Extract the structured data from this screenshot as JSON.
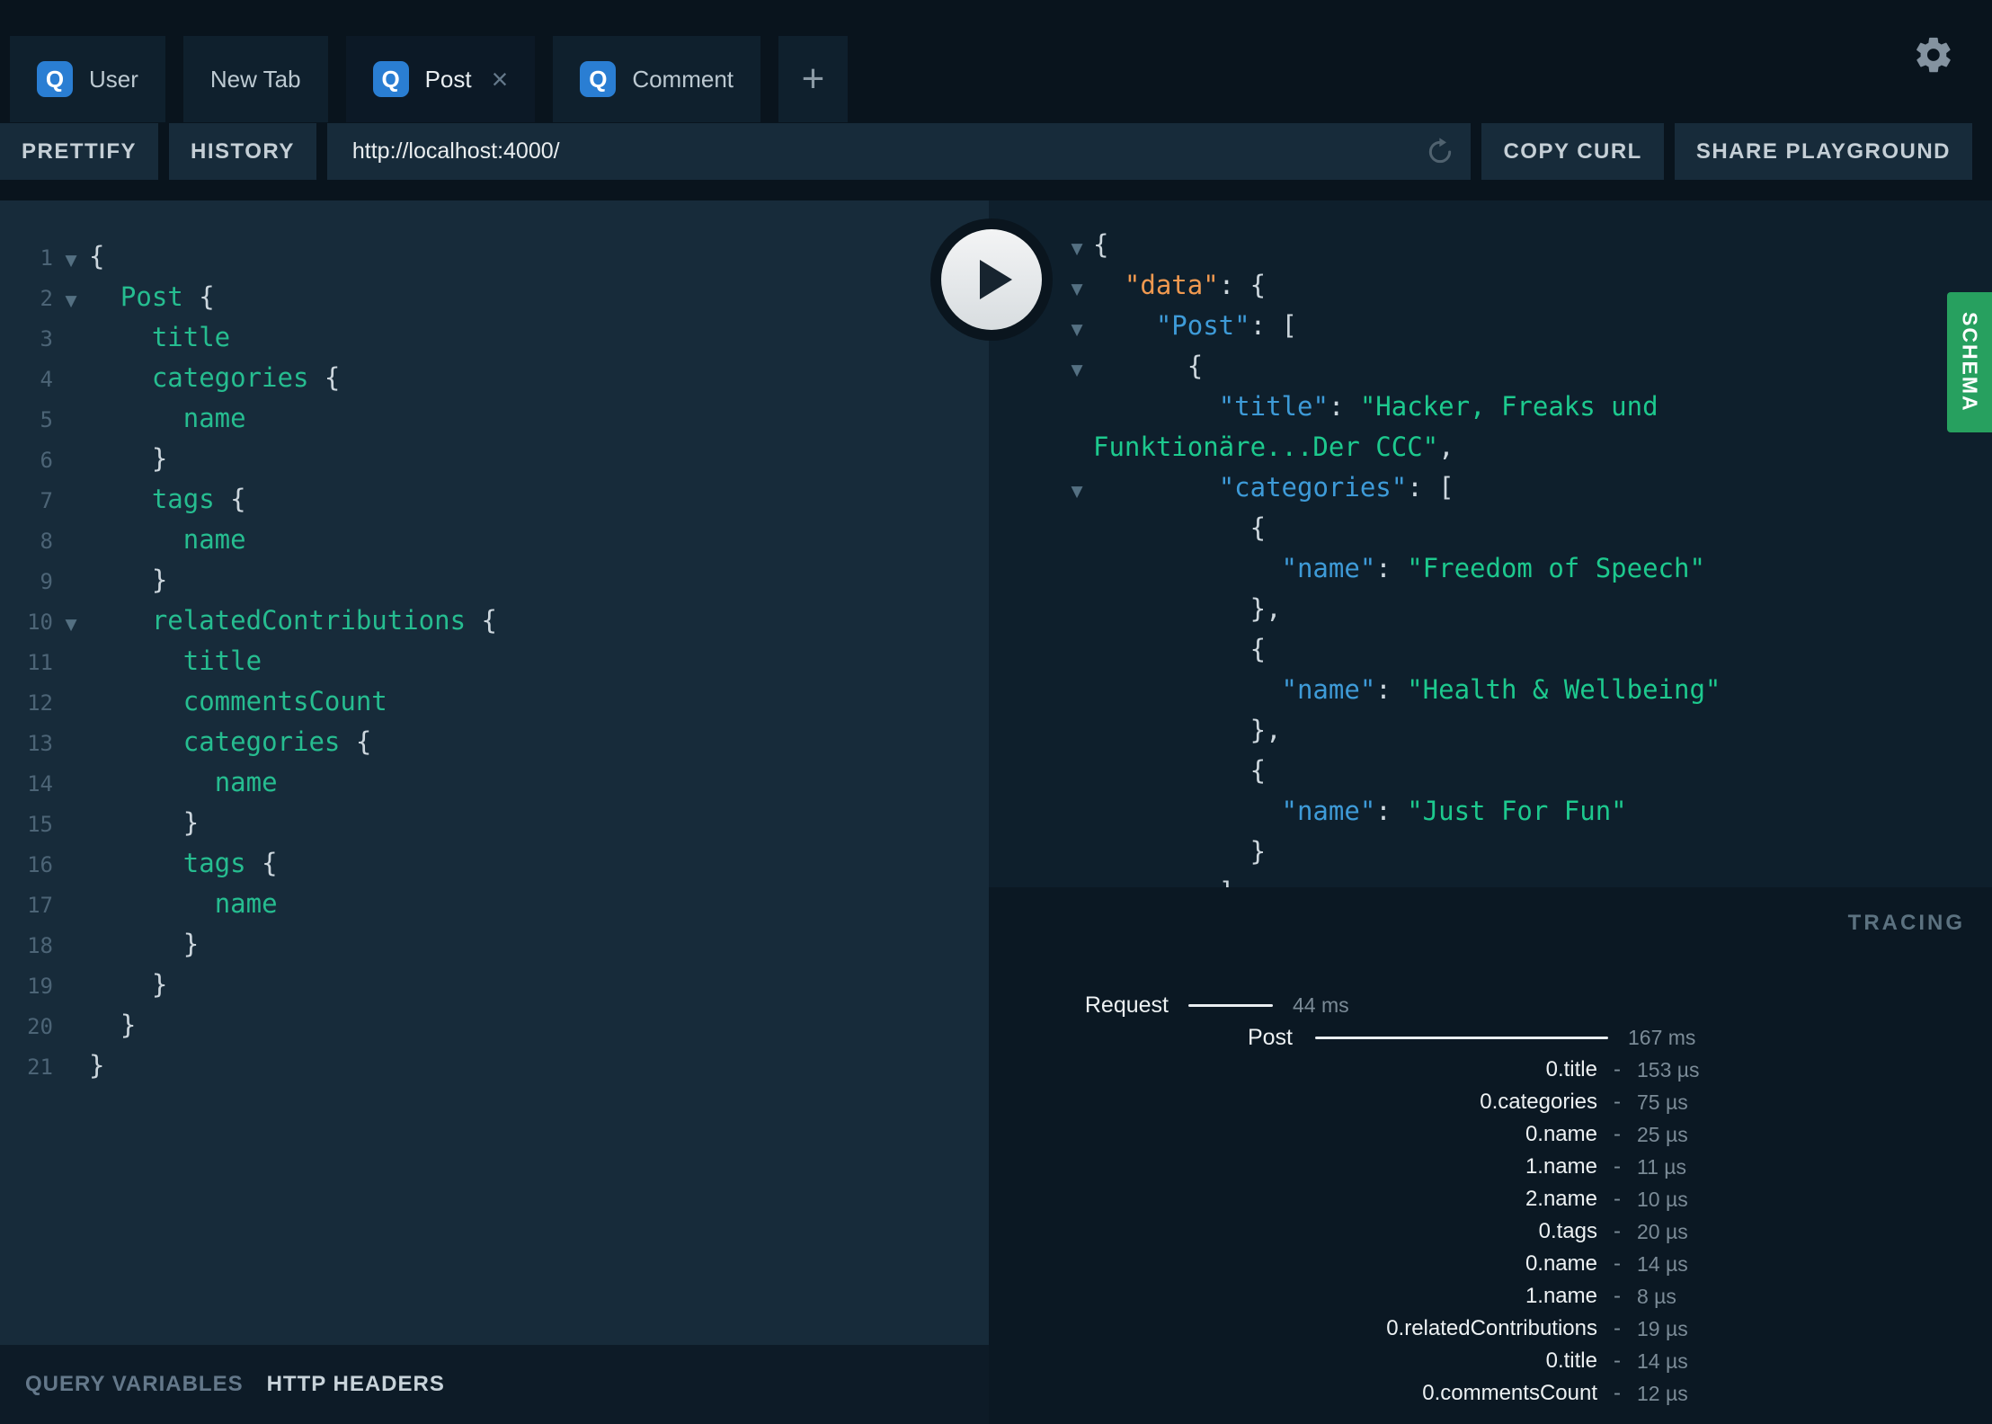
{
  "q_badge": "Q",
  "close_icon": "×",
  "new_tab_icon": "+",
  "caret_icon": "▼",
  "tabs": [
    {
      "label": "User",
      "q": true,
      "active": false,
      "closable": false
    },
    {
      "label": "New Tab",
      "q": false,
      "active": false,
      "closable": false
    },
    {
      "label": "Post",
      "q": true,
      "active": true,
      "closable": true
    },
    {
      "label": "Comment",
      "q": true,
      "active": false,
      "closable": false
    }
  ],
  "toolbar": {
    "prettify": "PRETTIFY",
    "history": "HISTORY",
    "url": "http://localhost:4000/",
    "copy_curl": "COPY CURL",
    "share": "SHARE PLAYGROUND"
  },
  "editor": {
    "lines": [
      {
        "n": "1",
        "fold": true,
        "indent": 0,
        "tokens": [
          [
            "p",
            "{"
          ]
        ]
      },
      {
        "n": "2",
        "fold": true,
        "indent": 1,
        "tokens": [
          [
            "f",
            "Post"
          ],
          [
            "p",
            " {"
          ]
        ]
      },
      {
        "n": "3",
        "indent": 2,
        "tokens": [
          [
            "f",
            "title"
          ]
        ]
      },
      {
        "n": "4",
        "indent": 2,
        "tokens": [
          [
            "f",
            "categories"
          ],
          [
            "p",
            " {"
          ]
        ]
      },
      {
        "n": "5",
        "indent": 3,
        "tokens": [
          [
            "f",
            "name"
          ]
        ]
      },
      {
        "n": "6",
        "indent": 2,
        "tokens": [
          [
            "p",
            "}"
          ]
        ]
      },
      {
        "n": "7",
        "indent": 2,
        "tokens": [
          [
            "f",
            "tags"
          ],
          [
            "p",
            " {"
          ]
        ]
      },
      {
        "n": "8",
        "indent": 3,
        "tokens": [
          [
            "f",
            "name"
          ]
        ]
      },
      {
        "n": "9",
        "indent": 2,
        "tokens": [
          [
            "p",
            "}"
          ]
        ]
      },
      {
        "n": "10",
        "fold": true,
        "indent": 2,
        "tokens": [
          [
            "f",
            "relatedContributions"
          ],
          [
            "p",
            " {"
          ]
        ]
      },
      {
        "n": "11",
        "indent": 3,
        "tokens": [
          [
            "f",
            "title"
          ]
        ]
      },
      {
        "n": "12",
        "indent": 3,
        "tokens": [
          [
            "f",
            "commentsCount"
          ]
        ]
      },
      {
        "n": "13",
        "indent": 3,
        "tokens": [
          [
            "f",
            "categories"
          ],
          [
            "p",
            " {"
          ]
        ]
      },
      {
        "n": "14",
        "indent": 4,
        "tokens": [
          [
            "f",
            "name"
          ]
        ]
      },
      {
        "n": "15",
        "indent": 3,
        "tokens": [
          [
            "p",
            "}"
          ]
        ]
      },
      {
        "n": "16",
        "indent": 3,
        "tokens": [
          [
            "f",
            "tags"
          ],
          [
            "p",
            " {"
          ]
        ]
      },
      {
        "n": "17",
        "indent": 4,
        "tokens": [
          [
            "f",
            "name"
          ]
        ]
      },
      {
        "n": "18",
        "indent": 3,
        "tokens": [
          [
            "p",
            "}"
          ]
        ]
      },
      {
        "n": "19",
        "indent": 2,
        "tokens": [
          [
            "p",
            "}"
          ]
        ]
      },
      {
        "n": "20",
        "indent": 1,
        "tokens": [
          [
            "p",
            "}"
          ]
        ]
      },
      {
        "n": "21",
        "indent": 0,
        "tokens": [
          [
            "p",
            "}"
          ]
        ]
      }
    ]
  },
  "response": {
    "lines": [
      {
        "fold": true,
        "indent": 0,
        "tokens": [
          [
            "p",
            "{"
          ]
        ]
      },
      {
        "fold": true,
        "indent": 1,
        "tokens": [
          [
            "kd",
            "\"data\""
          ],
          [
            "p",
            ": {"
          ]
        ]
      },
      {
        "fold": true,
        "indent": 2,
        "tokens": [
          [
            "k",
            "\"Post\""
          ],
          [
            "p",
            ": ["
          ]
        ]
      },
      {
        "fold": true,
        "indent": 3,
        "tokens": [
          [
            "p",
            "{"
          ]
        ]
      },
      {
        "indent": 4,
        "tokens": [
          [
            "k",
            "\"title\""
          ],
          [
            "p",
            ": "
          ],
          [
            "s",
            "\"Hacker, Freaks und"
          ]
        ]
      },
      {
        "indent": 0,
        "tokens": [
          [
            "s",
            "Funktionäre...Der CCC\""
          ],
          [
            "p",
            ","
          ]
        ]
      },
      {
        "fold": true,
        "indent": 4,
        "tokens": [
          [
            "k",
            "\"categories\""
          ],
          [
            "p",
            ": ["
          ]
        ]
      },
      {
        "indent": 5,
        "tokens": [
          [
            "p",
            "{"
          ]
        ]
      },
      {
        "indent": 6,
        "tokens": [
          [
            "k",
            "\"name\""
          ],
          [
            "p",
            ": "
          ],
          [
            "s",
            "\"Freedom of Speech\""
          ]
        ]
      },
      {
        "indent": 5,
        "tokens": [
          [
            "p",
            "},"
          ]
        ]
      },
      {
        "indent": 5,
        "tokens": [
          [
            "p",
            "{"
          ]
        ]
      },
      {
        "indent": 6,
        "tokens": [
          [
            "k",
            "\"name\""
          ],
          [
            "p",
            ": "
          ],
          [
            "s",
            "\"Health & Wellbeing\""
          ]
        ]
      },
      {
        "indent": 5,
        "tokens": [
          [
            "p",
            "},"
          ]
        ]
      },
      {
        "indent": 5,
        "tokens": [
          [
            "p",
            "{"
          ]
        ]
      },
      {
        "indent": 6,
        "tokens": [
          [
            "k",
            "\"name\""
          ],
          [
            "p",
            ": "
          ],
          [
            "s",
            "\"Just For Fun\""
          ]
        ]
      },
      {
        "indent": 5,
        "tokens": [
          [
            "p",
            "}"
          ]
        ]
      },
      {
        "indent": 4,
        "tokens": [
          [
            "p",
            "]"
          ]
        ]
      }
    ]
  },
  "schema_tab": "SCHEMA",
  "footer": {
    "query_variables": "QUERY VARIABLES",
    "http_headers": "HTTP HEADERS"
  },
  "tracing": {
    "title": "TRACING",
    "dash": "-",
    "spans": [
      {
        "label": "Request",
        "value": "44 ms",
        "kind": "request"
      },
      {
        "label": "Post",
        "value": "167 ms",
        "kind": "root"
      },
      {
        "label": "0.title",
        "value": "153 µs",
        "kind": "field"
      },
      {
        "label": "0.categories",
        "value": "75 µs",
        "kind": "field"
      },
      {
        "label": "0.name",
        "value": "25 µs",
        "kind": "field"
      },
      {
        "label": "1.name",
        "value": "11 µs",
        "kind": "field"
      },
      {
        "label": "2.name",
        "value": "10 µs",
        "kind": "field"
      },
      {
        "label": "0.tags",
        "value": "20 µs",
        "kind": "field"
      },
      {
        "label": "0.name",
        "value": "14 µs",
        "kind": "field"
      },
      {
        "label": "1.name",
        "value": "8 µs",
        "kind": "field"
      },
      {
        "label": "0.relatedContributions",
        "value": "19 µs",
        "kind": "field"
      },
      {
        "label": "0.title",
        "value": "14 µs",
        "kind": "field"
      },
      {
        "label": "0.commentsCount",
        "value": "12 µs",
        "kind": "field"
      }
    ]
  },
  "colors": {
    "accent_blue": "#2a7ed3",
    "schema_green": "#27a05f",
    "key_blue": "#3e9bd8",
    "data_orange": "#f09950",
    "string_green": "#1dc98e",
    "field_green": "#26bd90",
    "editor_bg": "#172b3a",
    "result_bg": "#0e1f2c",
    "page_bg": "#09141d"
  }
}
